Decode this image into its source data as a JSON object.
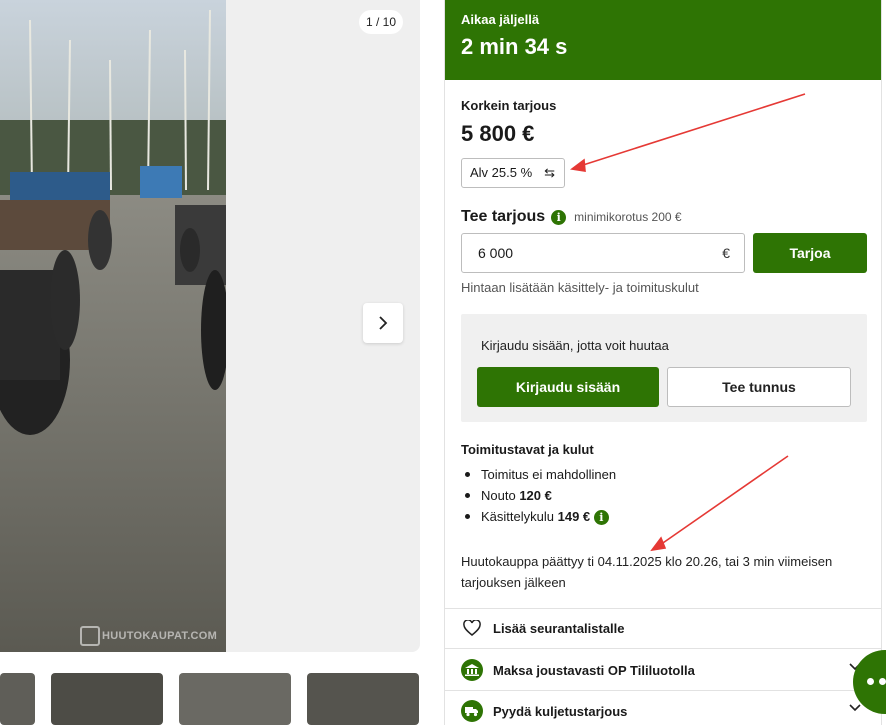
{
  "gallery": {
    "counter": "1 / 10",
    "watermark": "HUUTOKAUPAT.COM"
  },
  "timer": {
    "label": "Aikaa jäljellä",
    "value": "2 min 34 s"
  },
  "highest_bid": {
    "label": "Korkein tarjous",
    "amount": "5 800 €",
    "vat_toggle": "Alv 25.5 %"
  },
  "make_bid": {
    "title": "Tee tarjous",
    "min_increment": "minimikorotus 200 €",
    "input_value": "6 000",
    "currency": "€",
    "submit_label": "Tarjoa",
    "fees_note": "Hintaan lisätään käsittely- ja toimituskulut"
  },
  "login_box": {
    "text": "Kirjaudu sisään, jotta voit huutaa",
    "login_label": "Kirjaudu sisään",
    "signup_label": "Tee tunnus"
  },
  "delivery": {
    "title": "Toimitustavat ja kulut",
    "items": [
      {
        "text": "Toimitus ei mahdollinen",
        "value": ""
      },
      {
        "text": "Nouto",
        "value": "120 €"
      },
      {
        "text": "Käsittelykulu",
        "value": "149 €"
      }
    ]
  },
  "auction_end": "Huutokauppa päättyy ti 04.11.2025 klo 20.26, tai 3 min viimeisen tarjouksen jälkeen",
  "rows": {
    "watchlist": "Lisää seurantalistalle",
    "financing": "Maksa joustavasti OP Tililuotolla",
    "shipping_quote": "Pyydä kuljetustarjous"
  },
  "colors": {
    "brand_green": "#2e7404",
    "annotation_red": "#e53935"
  }
}
